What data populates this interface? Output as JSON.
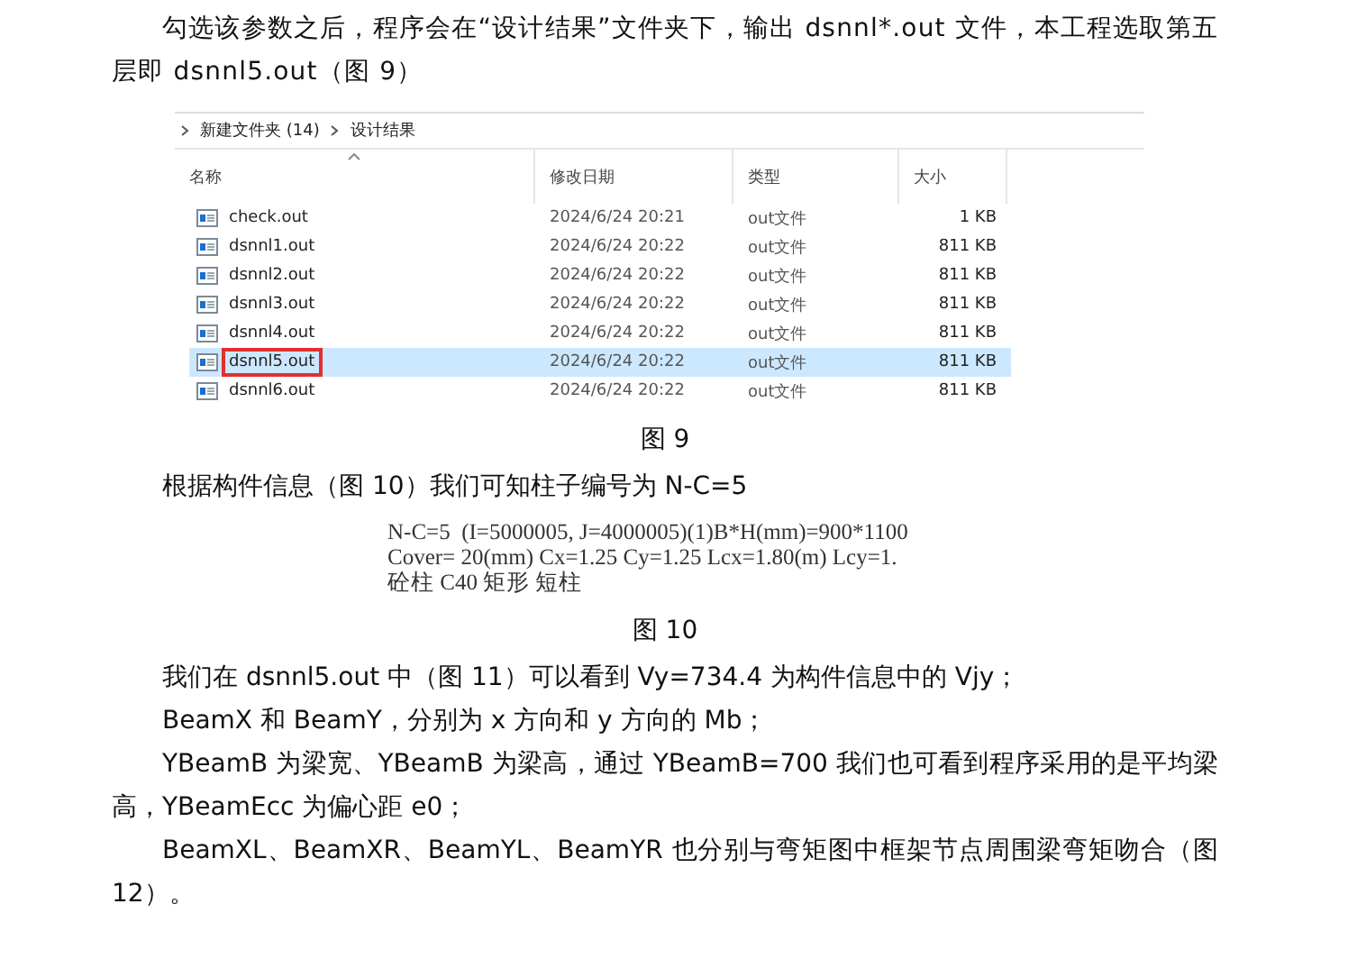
{
  "intro_paragraph": "勾选该参数之后，程序会在“设计结果”文件夹下，输出 dsnnl*.out 文件，本工程选取第五层即 dsnnl5.out（图 9）",
  "figure_9": {
    "breadcrumb": [
      "新建文件夹 (14)",
      "设计结果"
    ],
    "columns": [
      "名称",
      "修改日期",
      "类型",
      "大小"
    ],
    "rows": [
      {
        "name": "check.out",
        "modified": "2024/6/24 20:21",
        "type": "out文件",
        "size": "1 KB",
        "selected": false,
        "outlined": false
      },
      {
        "name": "dsnnl1.out",
        "modified": "2024/6/24 20:22",
        "type": "out文件",
        "size": "811 KB",
        "selected": false,
        "outlined": false
      },
      {
        "name": "dsnnl2.out",
        "modified": "2024/6/24 20:22",
        "type": "out文件",
        "size": "811 KB",
        "selected": false,
        "outlined": false
      },
      {
        "name": "dsnnl3.out",
        "modified": "2024/6/24 20:22",
        "type": "out文件",
        "size": "811 KB",
        "selected": false,
        "outlined": false
      },
      {
        "name": "dsnnl4.out",
        "modified": "2024/6/24 20:22",
        "type": "out文件",
        "size": "811 KB",
        "selected": false,
        "outlined": false
      },
      {
        "name": "dsnnl5.out",
        "modified": "2024/6/24 20:22",
        "type": "out文件",
        "size": "811 KB",
        "selected": true,
        "outlined": true
      },
      {
        "name": "dsnnl6.out",
        "modified": "2024/6/24 20:22",
        "type": "out文件",
        "size": "811 KB",
        "selected": false,
        "outlined": false
      }
    ],
    "caption": "图 9"
  },
  "middle_paragraph": "根据构件信息（图 10）我们可知柱子编号为 N-C=5",
  "figure_10": {
    "lines": [
      "N-C=5  (I=5000005, J=4000005)(1)B*H(mm)=900*1100",
      "Cover= 20(mm) Cx=1.25 Cy=1.25 Lcx=1.80(m) Lcy=1.",
      "砼柱 C40 矩形 短柱"
    ],
    "caption": "图 10"
  },
  "paragraphs": [
    "我们在 dsnnl5.out 中（图 11）可以看到 Vy=734.4 为构件信息中的 Vjy；",
    "BeamX 和 BeamY，分别为 x 方向和 y 方向的 Mb；",
    "YBeamB 为梁宽、YBeamB 为梁高，通过 YBeamB=700 我们也可看到程序采用的是平均梁高，YBeamEcc 为偏心距 e0；",
    "BeamXL、BeamXR、BeamYL、BeamYR 也分别与弯矩图中框架节点周围梁弯矩吻合（图 12）。"
  ]
}
